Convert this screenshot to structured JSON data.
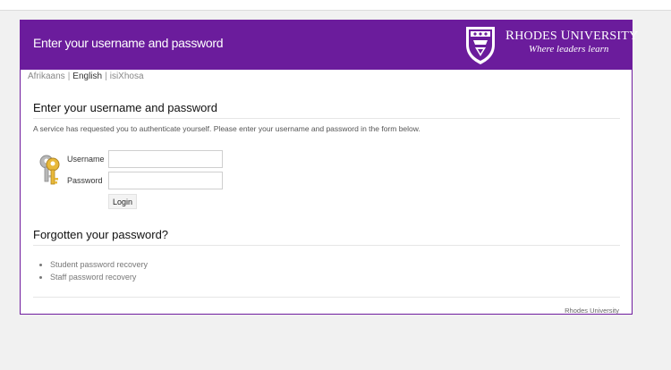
{
  "banner": {
    "title": "Enter your username and password",
    "university_name_prefix": "R",
    "university_name_rest": "HODES ",
    "university_name_u": "U",
    "university_name_rest2": "NIVERSITY",
    "tagline": "Where leaders learn"
  },
  "languages": {
    "items": [
      "Afrikaans",
      "English",
      "isiXhosa"
    ],
    "current": "English",
    "separator": "|"
  },
  "login": {
    "heading": "Enter your username and password",
    "intro": "A service has requested you to authenticate yourself. Please enter your username and password in the form below.",
    "username_label": "Username",
    "username_value": "",
    "password_label": "Password",
    "password_value": "",
    "button_label": "Login",
    "icon": "keys-icon"
  },
  "forgot": {
    "heading": "Forgotten your password?",
    "links": [
      "Student password recovery",
      "Staff password recovery"
    ]
  },
  "footer": {
    "text": "Rhodes University"
  },
  "colors": {
    "brand_purple": "#6b1c9c",
    "page_background": "#f1f1f1"
  }
}
